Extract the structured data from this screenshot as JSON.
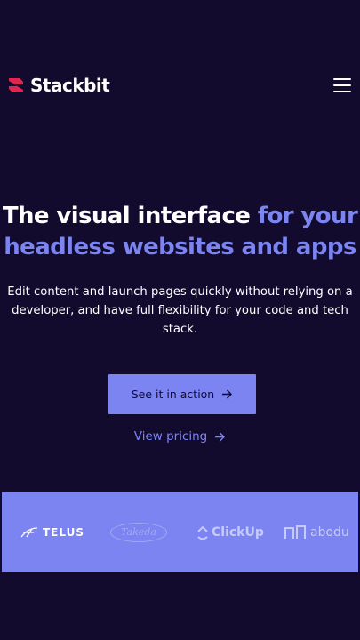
{
  "header": {
    "brand_name": "Stackbit",
    "logo_icon": "stackbit-logo-icon",
    "menu_icon": "hamburger-menu-icon"
  },
  "hero": {
    "title_main": "The visual interface ",
    "title_accent": "for your headless websites and apps",
    "subtitle": "Edit content and launch pages quickly without relying on a developer, and have full flexibility for your code and tech stack."
  },
  "actions": {
    "primary_label": "See it in action",
    "secondary_label": "View pricing",
    "arrow_icon": "arrow-right-icon"
  },
  "logos": {
    "items": [
      "TELUS",
      "Takeda",
      "ClickUp",
      "abodu"
    ]
  },
  "colors": {
    "background": "#120b2e",
    "accent": "#7b84f0",
    "brand_red": "#e0254f",
    "text": "#ffffff"
  }
}
